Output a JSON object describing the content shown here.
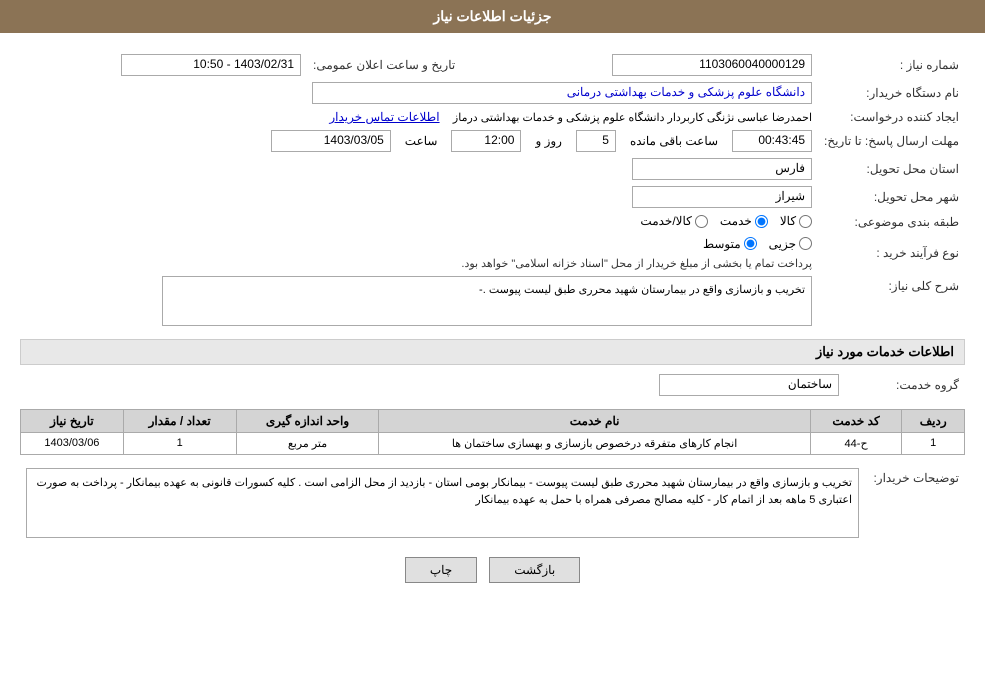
{
  "header": {
    "title": "جزئیات اطلاعات نیاز"
  },
  "form": {
    "need_number_label": "شماره نیاز :",
    "need_number_value": "1103060040000129",
    "org_name_label": "نام دستگاه خریدار:",
    "org_name_value": "دانشگاه علوم پزشکی و خدمات بهداشتی درمانی",
    "creator_label": "ایجاد کننده درخواست:",
    "creator_value": "احمدرضا عباسی نژنگی کاربردار دانشگاه علوم پزشکی و خدمات بهداشتی درماز",
    "contact_link": "اطلاعات تماس خریدار",
    "response_deadline_label": "مهلت ارسال پاسخ: تا تاریخ:",
    "date_value": "1403/03/05",
    "time_label": "ساعت",
    "time_value": "12:00",
    "day_label": "روز و",
    "day_value": "5",
    "remaining_label": "ساعت باقی مانده",
    "remaining_value": "00:43:45",
    "province_label": "استان محل تحویل:",
    "province_value": "فارس",
    "city_label": "شهر محل تحویل:",
    "city_value": "شیراز",
    "category_label": "طبقه بندی موضوعی:",
    "category_options": [
      "کالا",
      "خدمت",
      "کالا/خدمت"
    ],
    "category_selected": "خدمت",
    "purchase_type_label": "نوع فرآیند خرید :",
    "purchase_types": [
      "جزیی",
      "متوسط"
    ],
    "purchase_desc": "پرداخت تمام یا بخشی از مبلغ خریدار از محل \"اسناد خزانه اسلامی\" خواهد بود.",
    "description_label": "شرح کلی نیاز:",
    "description_value": "تخریب و بازسازی واقع در بیمارستان شهید محرری طبق لیست پیوست .-",
    "announce_label": "تاریخ و ساعت اعلان عمومی:",
    "announce_value": "1403/02/31 - 10:50"
  },
  "services_section": {
    "title": "اطلاعات خدمات مورد نیاز",
    "service_group_label": "گروه خدمت:",
    "service_group_value": "ساختمان",
    "table": {
      "columns": [
        "ردیف",
        "کد خدمت",
        "نام خدمت",
        "واحد اندازه گیری",
        "تعداد / مقدار",
        "تاریخ نیاز"
      ],
      "rows": [
        {
          "row_num": "1",
          "service_code": "ح-44",
          "service_name": "انجام کارهای متفرقه درخصوص بازسازی و بهسازی ساختمان ها",
          "unit": "متر مربع",
          "quantity": "1",
          "date": "1403/03/06"
        }
      ]
    }
  },
  "notes": {
    "label": "توضیحات خریدار:",
    "value": "تخریب و بازسازی واقع در بیمارستان شهید محرری طبق لیست پیوست - بیمانکار بومی استان - بازدید از محل الزامی است . کلیه کسورات قانونی به عهده بیمانکار - پرداخت به صورت اعتباری 5 ماهه بعد از اتمام کار - کلیه مصالح مصرفی همراه با حمل به عهده بیمانکار"
  },
  "buttons": {
    "print_label": "چاپ",
    "back_label": "بازگشت"
  }
}
